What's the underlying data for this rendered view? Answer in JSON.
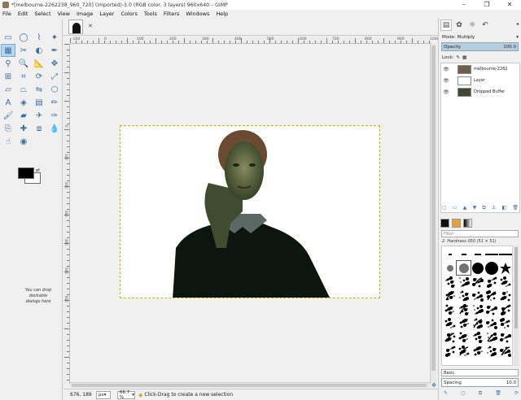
{
  "window": {
    "title": "*[melbourne-2262238_960_720] (imported)-3.0 (RGB color, 3 layers) 960x640 – GIMP",
    "min": "–",
    "max": "❐",
    "close": "✕"
  },
  "menu": [
    "File",
    "Edit",
    "Select",
    "View",
    "Image",
    "Layer",
    "Colors",
    "Tools",
    "Filters",
    "Windows",
    "Help"
  ],
  "toolbox": {
    "tools": [
      {
        "name": "rect-select-icon",
        "glyph": "▭"
      },
      {
        "name": "ellipse-select-icon",
        "glyph": "◯"
      },
      {
        "name": "free-select-icon",
        "glyph": "⌇"
      },
      {
        "name": "fuzzy-select-icon",
        "glyph": "✦"
      },
      {
        "name": "select-by-color-icon",
        "glyph": "▦",
        "selected": true
      },
      {
        "name": "scissors-select-icon",
        "glyph": "✂"
      },
      {
        "name": "foreground-select-icon",
        "glyph": "◐"
      },
      {
        "name": "paths-icon",
        "glyph": "✒"
      },
      {
        "name": "color-picker-icon",
        "glyph": "⚲"
      },
      {
        "name": "zoom-icon",
        "glyph": "🔍"
      },
      {
        "name": "measure-icon",
        "glyph": "📐"
      },
      {
        "name": "move-icon",
        "glyph": "✥"
      },
      {
        "name": "align-icon",
        "glyph": "⊞"
      },
      {
        "name": "crop-icon",
        "glyph": "⌗"
      },
      {
        "name": "rotate-icon",
        "glyph": "⟳"
      },
      {
        "name": "scale-icon",
        "glyph": "⤢"
      },
      {
        "name": "shear-icon",
        "glyph": "▱"
      },
      {
        "name": "perspective-icon",
        "glyph": "⏢"
      },
      {
        "name": "flip-icon",
        "glyph": "⇋"
      },
      {
        "name": "cage-icon",
        "glyph": "⬡"
      },
      {
        "name": "text-icon",
        "glyph": "A"
      },
      {
        "name": "bucket-fill-icon",
        "glyph": "◈"
      },
      {
        "name": "blend-icon",
        "glyph": "▤"
      },
      {
        "name": "pencil-icon",
        "glyph": "✏"
      },
      {
        "name": "paintbrush-icon",
        "glyph": "🖌"
      },
      {
        "name": "eraser-icon",
        "glyph": "▰"
      },
      {
        "name": "airbrush-icon",
        "glyph": "✈"
      },
      {
        "name": "ink-icon",
        "glyph": "✑"
      },
      {
        "name": "clone-icon",
        "glyph": "⎘"
      },
      {
        "name": "heal-icon",
        "glyph": "✚"
      },
      {
        "name": "perspective-clone-icon",
        "glyph": "⧈"
      },
      {
        "name": "blur-icon",
        "glyph": "💧"
      },
      {
        "name": "smudge-icon",
        "glyph": "☝"
      },
      {
        "name": "dodge-burn-icon",
        "glyph": "◉"
      }
    ],
    "dock_hint": "You can drop dockable dialogs here"
  },
  "image_tab": {
    "close": "✕"
  },
  "hruler_labels": [
    "-100",
    "0",
    "100",
    "200",
    "300",
    "400",
    "500",
    "600",
    "700",
    "800",
    "900",
    "1000"
  ],
  "vruler_labels": [
    "0",
    "100",
    "200",
    "300",
    "400",
    "500",
    "600"
  ],
  "status": {
    "coords": "676, 189",
    "unit": "px",
    "zoom": "66.7 %",
    "message": "Click-Drag to create a new selection"
  },
  "layers_panel": {
    "mode_label": "Mode: Multiply",
    "opacity_label": "Opacity",
    "opacity_value": "100.0",
    "lock_label": "Lock:",
    "layers": [
      {
        "name": "melbourne-2262",
        "thumb": "#6e6048",
        "selected": false
      },
      {
        "name": "Layer",
        "thumb": "#ffffff",
        "selected": false
      },
      {
        "name": "Dropped Buffer",
        "thumb": "#3f4a2e",
        "selected": false
      }
    ]
  },
  "brushes_panel": {
    "filter_placeholder": "Filter",
    "brush_name": "2. Hardness 050 (51 × 51)",
    "preset": "Basic.",
    "spacing_label": "Spacing",
    "spacing_value": "10.0"
  }
}
